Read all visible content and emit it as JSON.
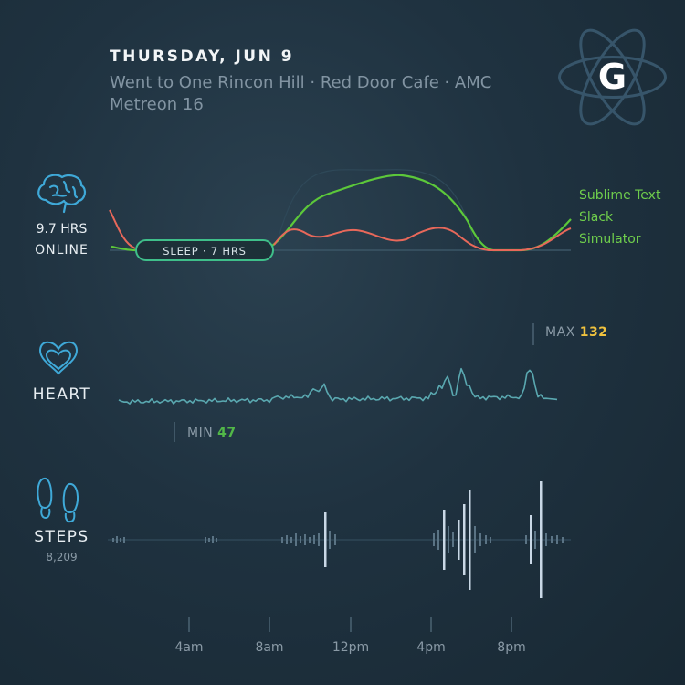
{
  "header": {
    "date": "THURSDAY, JUN 9",
    "places": "Went to One Rincon Hill · Red Door Cafe · AMC Metreon 16",
    "logo_letter": "G"
  },
  "online": {
    "hours": "9.7 HRS",
    "label": "ONLINE",
    "sleep_badge": "SLEEP · 7 HRS",
    "legend": [
      "Sublime Text",
      "Slack",
      "Simulator"
    ],
    "colors": {
      "sublime": "#5cc83a",
      "slack": "#e8685a",
      "simulator": "#6fce4c"
    }
  },
  "heart": {
    "label": "HEART",
    "max_label": "MAX",
    "max_value": "132",
    "min_label": "MIN",
    "min_value": "47",
    "color": "#5aa8b0"
  },
  "steps": {
    "label": "STEPS",
    "count": "8,209"
  },
  "timeline": {
    "ticks": [
      "4am",
      "8am",
      "12pm",
      "4pm",
      "8pm"
    ]
  },
  "icons": [
    "brain-icon",
    "heart-icon",
    "footprints-icon",
    "atom-logo-icon"
  ]
}
